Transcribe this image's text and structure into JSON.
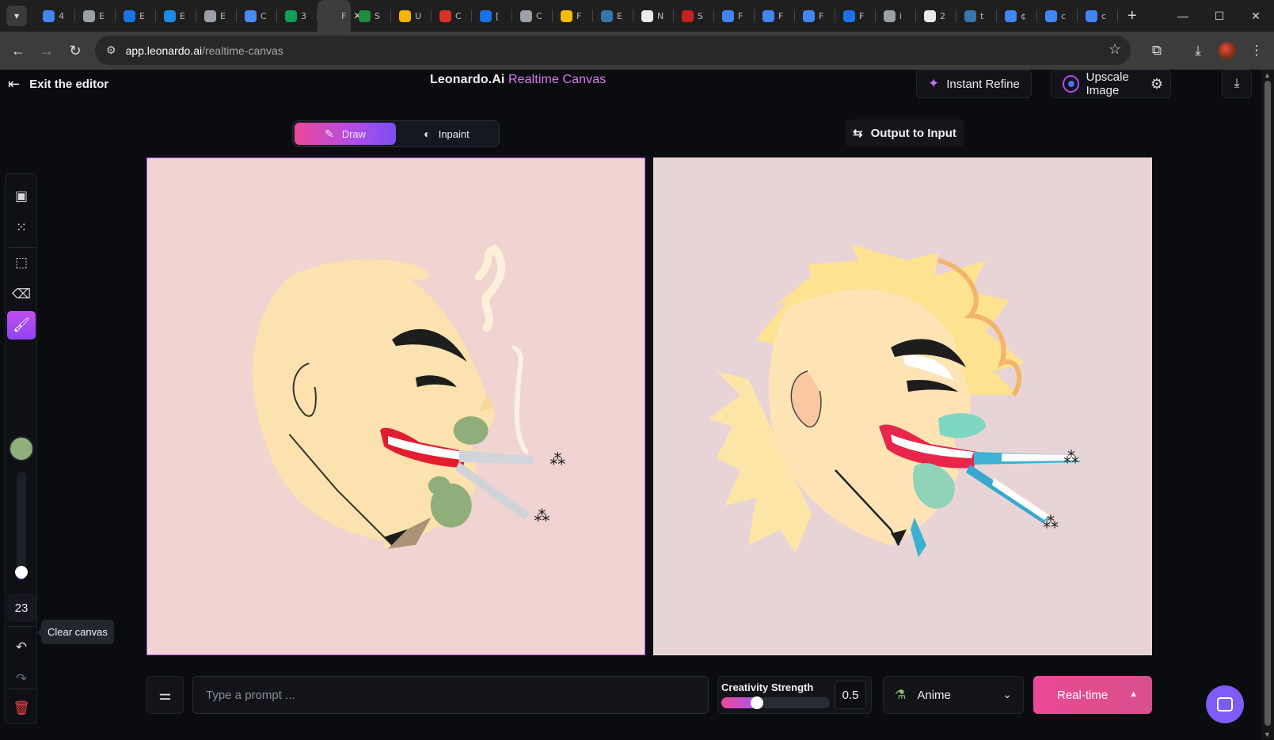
{
  "browser": {
    "tab_menu_icon": "chevron-down-icon",
    "tabs": [
      {
        "label": "4",
        "color": "#4285f4"
      },
      {
        "label": "E",
        "color": "#9aa0a6"
      },
      {
        "label": "E",
        "color": "#1a73e8"
      },
      {
        "label": "E",
        "color": "#1e88e5"
      },
      {
        "label": "E",
        "color": "#9aa0a6"
      },
      {
        "label": "C",
        "color": "#4a8af4"
      },
      {
        "label": "3",
        "color": "#0f9d58"
      },
      {
        "label": "F",
        "color": "#3c3c3c",
        "active": true
      },
      {
        "label": "S",
        "color": "#1e8e3e"
      },
      {
        "label": "U",
        "color": "#f4b400"
      },
      {
        "label": "C",
        "color": "#d93025"
      },
      {
        "label": "[",
        "color": "#1a73e8"
      },
      {
        "label": "C",
        "color": "#9aa0a6"
      },
      {
        "label": "F",
        "color": "#fbbc04"
      },
      {
        "label": "E",
        "color": "#3776ab"
      },
      {
        "label": "N",
        "color": "#e8eaed"
      },
      {
        "label": "S",
        "color": "#c5221f"
      },
      {
        "label": "F",
        "color": "#4285f4"
      },
      {
        "label": "F",
        "color": "#4285f4"
      },
      {
        "label": "F",
        "color": "#4285f4"
      },
      {
        "label": "F",
        "color": "#1a73e8"
      },
      {
        "label": "i",
        "color": "#9aa0a6"
      },
      {
        "label": "2",
        "color": "#e8eaed"
      },
      {
        "label": "t",
        "color": "#3776ab"
      },
      {
        "label": "¢",
        "color": "#4285f4"
      },
      {
        "label": "c",
        "color": "#4285f4"
      },
      {
        "label": "c",
        "color": "#4285f4"
      }
    ],
    "new_tab": "+",
    "url_domain": "app.leonardo.ai",
    "url_path": "/realtime-canvas"
  },
  "header": {
    "exit_label": "Exit the editor",
    "brand": "Leonardo.Ai",
    "product": "Realtime Canvas",
    "instant_refine": "Instant Refine",
    "upscale_image": "Upscale Image"
  },
  "modes": {
    "draw": "Draw",
    "inpaint": "Inpaint",
    "active": "draw"
  },
  "output_to_input": "Output to Input",
  "tools": {
    "brush_color": "#8fae7a",
    "brush_size": "23",
    "brush_size_fraction": 0.1,
    "active_tool": "paint-brush",
    "tooltip": "Clear canvas"
  },
  "bottom": {
    "prompt_value": "",
    "prompt_placeholder": "Type a prompt ...",
    "creativity_label": "Creativity Strength",
    "creativity_value": "0.5",
    "creativity_fraction": 0.33,
    "style": "Anime",
    "realtime": "Real-time"
  },
  "colors": {
    "accent_pink": "#ec4899",
    "accent_purple": "#b04de8",
    "canvas_bg_left": "#f0d4d2",
    "canvas_bg_right": "#e8d4d6"
  }
}
